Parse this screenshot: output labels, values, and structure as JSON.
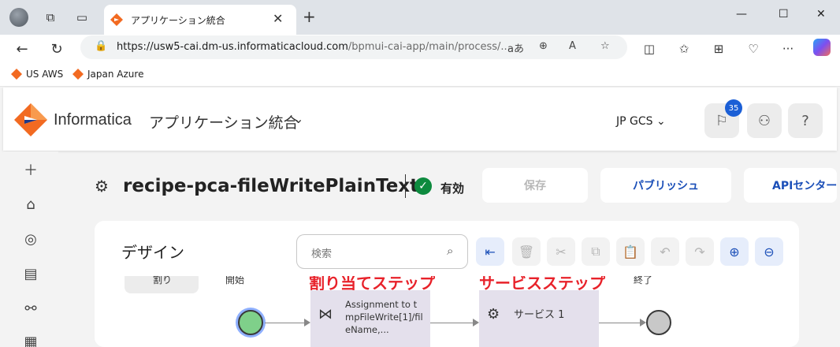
{
  "browser": {
    "tab_title": "アプリケーション統合",
    "tab_close": "✕",
    "new_tab": "+",
    "url_host": "https://usw5-cai.dm-us.informaticacloud.com",
    "url_path": "/bpmui-cai-app/main/process/...",
    "bookmarks": [
      "US AWS",
      "Japan Azure"
    ],
    "window_controls": {
      "minimize": "—",
      "maximize": "☐",
      "close": "✕"
    }
  },
  "app": {
    "brand": "Informatica",
    "product": "アプリケーション統合",
    "org": "JP GCS",
    "notification_count": "35",
    "help": "?"
  },
  "asset": {
    "title": "recipe-pca-fileWritePlainText",
    "status": "有効",
    "buttons": {
      "save": "保存",
      "publish": "パブリッシュ",
      "api_center": "APIセンター"
    }
  },
  "design": {
    "title": "デザイン",
    "search_placeholder": "検索",
    "palette_chip": "割り",
    "start_label": "開始",
    "end_label": "終了",
    "assignment_callout": "割り当てステップ",
    "service_callout": "サービスステップ",
    "assignment_step": "Assignment to tmpFileWrite[1]/fileName,...",
    "service_step": "サービス 1"
  },
  "colors": {
    "accent_blue": "#1b4fb8",
    "callout_red": "#e8222a",
    "status_green": "#0d8a3e",
    "step_bg": "#e4e0ec"
  }
}
